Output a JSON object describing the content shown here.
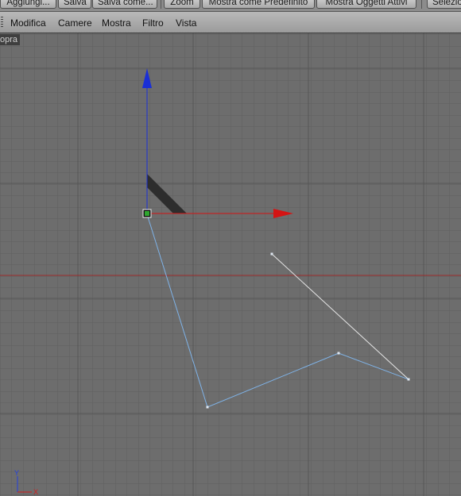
{
  "toolbar": {
    "buttons": [
      "Aggiungi...",
      "Salva",
      "Salva come...",
      "Zoom",
      "Mostra come Predefinito",
      "Mostra Oggetti Attivi",
      "Selezio"
    ]
  },
  "menu": {
    "items": [
      "Modifica",
      "Camere",
      "Mostra",
      "Filtro",
      "Vista"
    ]
  },
  "viewport": {
    "label": "opra",
    "axis_labels": {
      "y": "Y",
      "x": "X"
    }
  },
  "colors": {
    "grid": "#636363",
    "grid_major": "#585858",
    "horizon": "#9a2a2a",
    "y_axis": "#1a2fd6",
    "x_axis": "#d41414",
    "spline": "#7fb3e8",
    "segment": "#e6e6e6"
  },
  "icons": [
    "y-axis-arrow-icon",
    "x-axis-arrow-icon",
    "origin-handle-icon",
    "axis-gizmo-icon"
  ]
}
